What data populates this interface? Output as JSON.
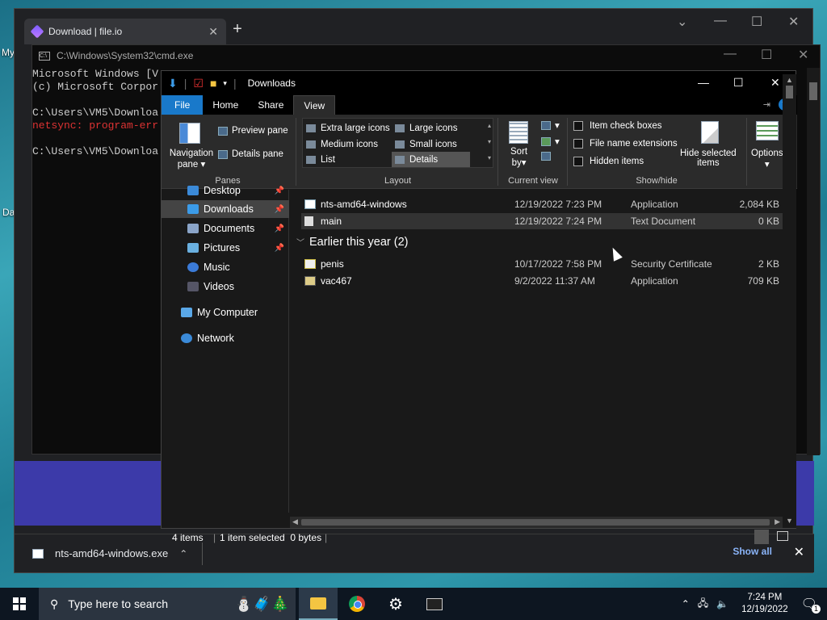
{
  "desktop": {
    "label_my": "My",
    "label_da": "Da"
  },
  "browser": {
    "tab_title": "Download | file.io",
    "new_tab_glyph": "+",
    "download_shelf": {
      "file_name": "nts-amd64-windows.exe",
      "show_all": "Show all"
    }
  },
  "cmd": {
    "title": "C:\\Windows\\System32\\cmd.exe",
    "lines": [
      "Microsoft Windows [V",
      "(c) Microsoft Corpor",
      "",
      "C:\\Users\\VM5\\Downloa",
      "netsync: program-err",
      "",
      "C:\\Users\\VM5\\Downloa"
    ]
  },
  "explorer": {
    "title": "Downloads",
    "ribbon_tabs": [
      "File",
      "Home",
      "Share",
      "View"
    ],
    "panes": {
      "navigation_pane": "Navigation",
      "navigation_pane_2": "pane",
      "preview_pane": "Preview pane",
      "details_pane": "Details pane",
      "group_label": "Panes"
    },
    "layout": {
      "items": [
        "Extra large icons",
        "Large icons",
        "Medium icons",
        "Small icons",
        "List",
        "Details"
      ],
      "group_label": "Layout"
    },
    "current_view": {
      "sort_by": "Sort",
      "sort_by_2": "by",
      "group_label": "Current view"
    },
    "show_hide": {
      "item_check_boxes": "Item check boxes",
      "file_name_extensions": "File name extensions",
      "hidden_items": "Hidden items",
      "hide_selected": "Hide selected",
      "hide_selected_2": "items",
      "group_label": "Show/hide"
    },
    "options": "Options",
    "nav_items": [
      {
        "label": "Desktop",
        "pinned": true
      },
      {
        "label": "Downloads",
        "pinned": true
      },
      {
        "label": "Documents",
        "pinned": true
      },
      {
        "label": "Pictures",
        "pinned": true
      },
      {
        "label": "Music",
        "pinned": false
      },
      {
        "label": "Videos",
        "pinned": false
      },
      {
        "label": "My Computer",
        "pinned": false
      },
      {
        "label": "Network",
        "pinned": false
      }
    ],
    "files_today": [
      {
        "name": "nts-amd64-windows",
        "date": "12/19/2022 7:23 PM",
        "type": "Application",
        "size": "2,084 KB"
      },
      {
        "name": "main",
        "date": "12/19/2022 7:24 PM",
        "type": "Text Document",
        "size": "0 KB"
      }
    ],
    "group_earlier": "Earlier this year (2)",
    "files_earlier": [
      {
        "name": "penis",
        "date": "10/17/2022 7:58 PM",
        "type": "Security Certificate",
        "size": "2 KB"
      },
      {
        "name": "vac467",
        "date": "9/2/2022 11:37 AM",
        "type": "Application",
        "size": "709 KB"
      }
    ],
    "status": {
      "items": "4 items",
      "selected": "1 item selected  0 bytes"
    }
  },
  "taskbar": {
    "search_placeholder": "Type here to search",
    "clock_time": "7:24 PM",
    "clock_date": "12/19/2022",
    "notification_count": "1"
  }
}
